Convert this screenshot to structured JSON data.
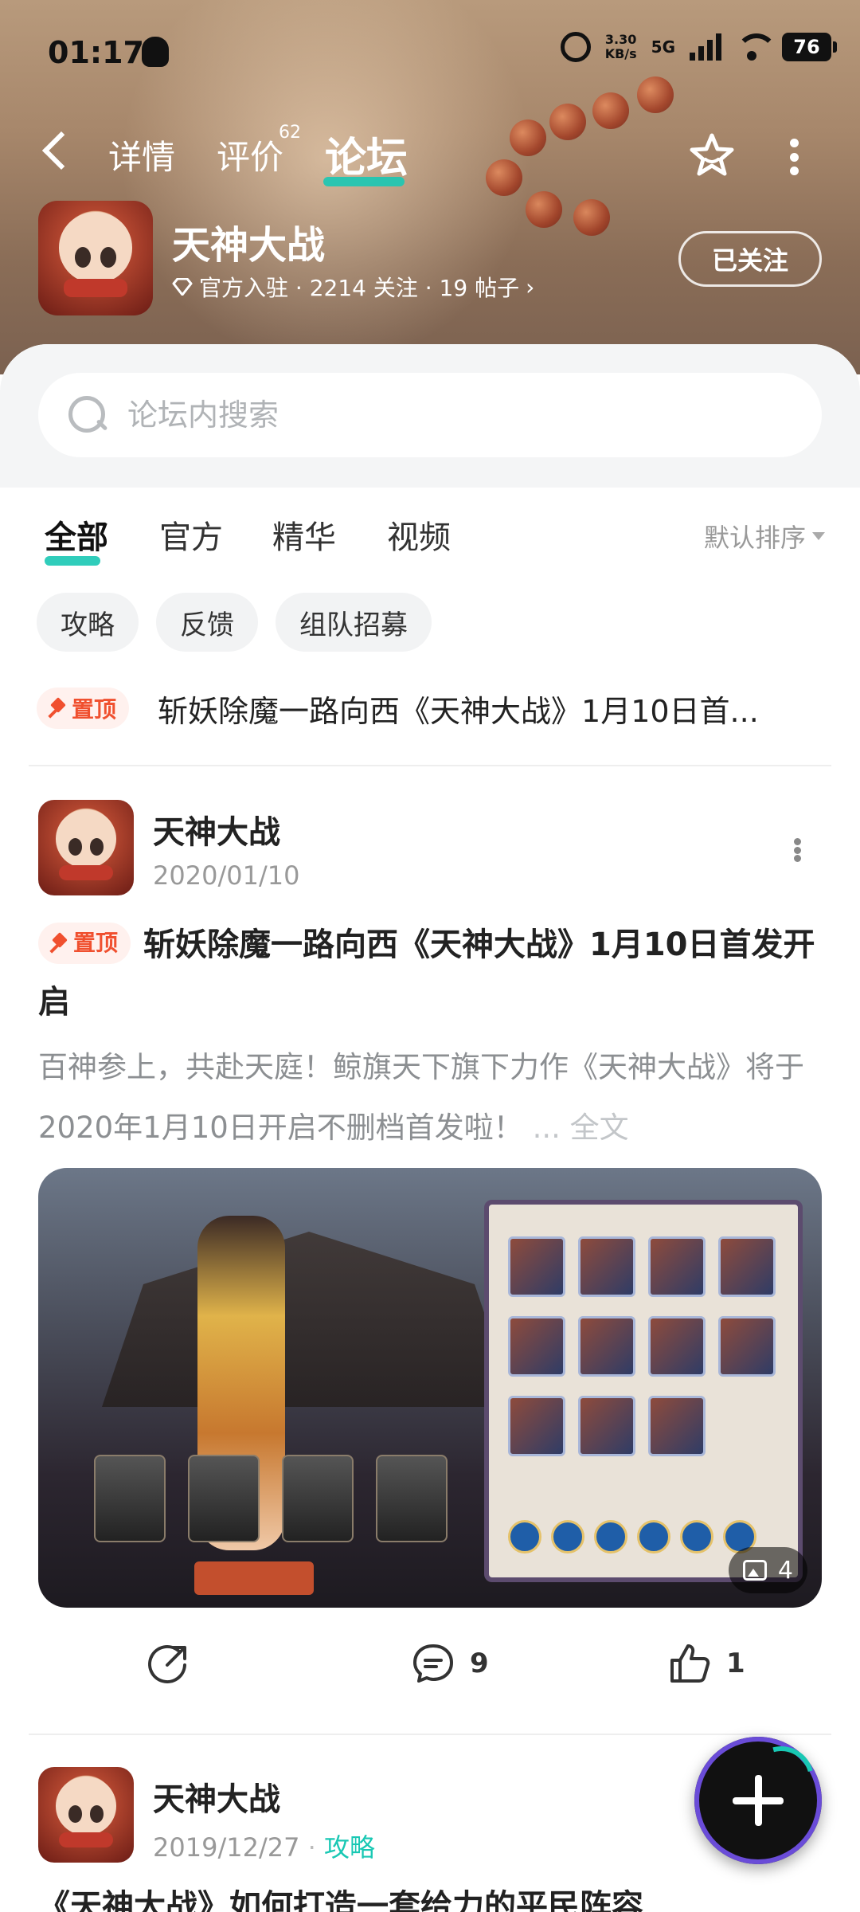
{
  "status_bar": {
    "time": "01:17",
    "speed_value": "3.30",
    "speed_unit": "KB/s",
    "network": "5G",
    "battery": "76"
  },
  "nav": {
    "tabs": [
      {
        "label": "详情"
      },
      {
        "label": "评价",
        "badge": "62"
      },
      {
        "label": "论坛"
      }
    ],
    "active_tab": "论坛"
  },
  "game": {
    "name": "天神大战",
    "meta": "官方入驻 · 2214 关注 · 19 帖子",
    "follow_label": "已关注"
  },
  "search": {
    "placeholder": "论坛内搜索"
  },
  "filter": {
    "tabs": [
      "全部",
      "官方",
      "精华",
      "视频"
    ],
    "active": "全部",
    "sort_label": "默认排序"
  },
  "chips": [
    "攻略",
    "反馈",
    "组队招募"
  ],
  "pinned": {
    "tag": "置顶",
    "title": "斩妖除魔一路向西《天神大战》1月10日首..."
  },
  "posts": [
    {
      "author": "天神大战",
      "date": "2020/01/10",
      "tag": "置顶",
      "title": "斩妖除魔一路向西《天神大战》1月10日首发开启",
      "excerpt": "百神参上，共赴天庭！鲸旗天下旗下力作《天神大战》将于2020年1月10日开启不删档首发啦！",
      "fulltext_label": "... 全文",
      "image_count": "4",
      "comments": "9",
      "likes": "1"
    },
    {
      "author": "天神大战",
      "date": "2019/12/27",
      "category": "攻略",
      "title": "《天神大战》如何打造一套给力的平民阵容"
    }
  ],
  "colors": {
    "accent": "#19c8b4",
    "pin": "#f0502f"
  }
}
